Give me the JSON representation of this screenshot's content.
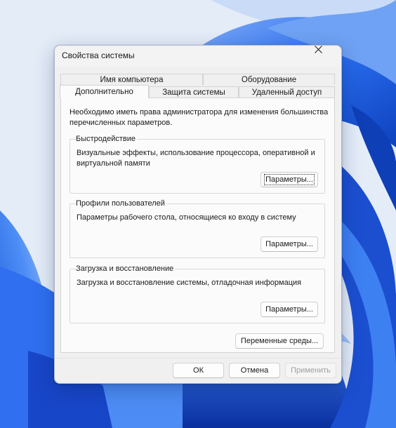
{
  "window": {
    "title": "Свойства системы",
    "close_icon": "close-icon"
  },
  "tabs": {
    "row_back": [
      {
        "label": "Имя компьютера"
      },
      {
        "label": "Оборудование"
      }
    ],
    "row_front": [
      {
        "label": "Дополнительно",
        "active": true
      },
      {
        "label": "Защита системы"
      },
      {
        "label": "Удаленный доступ"
      }
    ]
  },
  "panel": {
    "intro": "Необходимо иметь права администратора для изменения большинства перечисленных параметров.",
    "performance": {
      "title": "Быстродействие",
      "description": "Визуальные эффекты, использование процессора, оперативной и виртуальной памяти",
      "button": "Параметры..."
    },
    "profiles": {
      "title": "Профили пользователей",
      "description": "Параметры рабочего стола, относящиеся ко входу в систему",
      "button": "Параметры..."
    },
    "startup": {
      "title": "Загрузка и восстановление",
      "description": "Загрузка и восстановление системы, отладочная информация",
      "button": "Параметры..."
    },
    "env_button": "Переменные среды..."
  },
  "footer": {
    "ok": "ОК",
    "cancel": "Отмена",
    "apply": "Применить"
  },
  "colors": {
    "wallpaper_base": "#dfe8f6",
    "wallpaper_accent": "#1f5fe0",
    "dialog_bg": "#f0f0f0"
  }
}
